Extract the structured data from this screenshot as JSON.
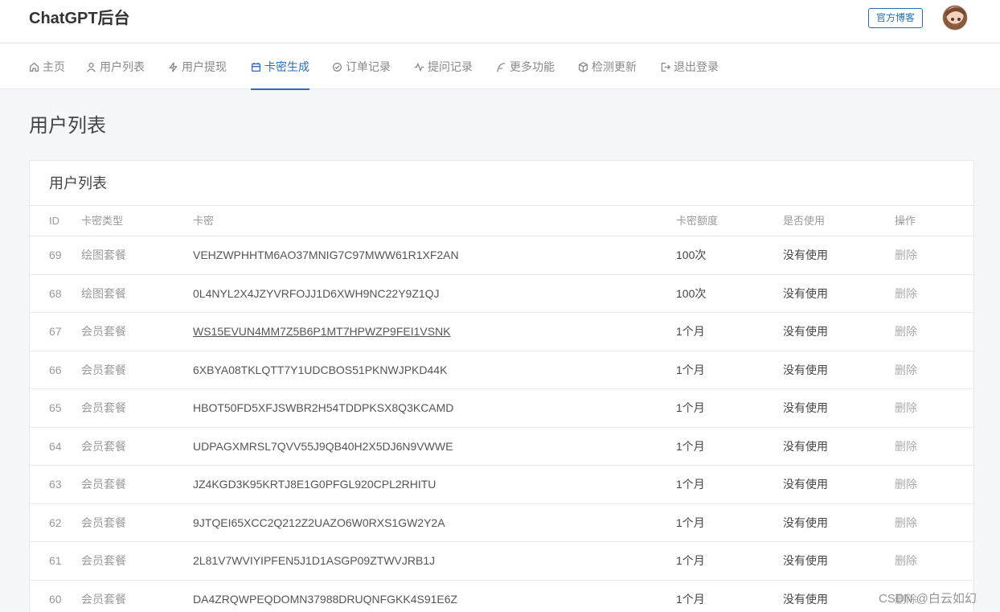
{
  "header": {
    "brand": "ChatGPT后台",
    "blog_button": "官方博客"
  },
  "nav": [
    {
      "label": "主页",
      "icon": "home-icon"
    },
    {
      "label": "用户列表",
      "icon": "user-icon"
    },
    {
      "label": "用户提现",
      "icon": "lightning-icon"
    },
    {
      "label": "卡密生成",
      "icon": "calendar-icon",
      "active": true
    },
    {
      "label": "订单记录",
      "icon": "check-circle-icon"
    },
    {
      "label": "提问记录",
      "icon": "activity-icon"
    },
    {
      "label": "更多功能",
      "icon": "feather-icon"
    },
    {
      "label": "检测更新",
      "icon": "box-icon"
    },
    {
      "label": "退出登录",
      "icon": "logout-icon"
    }
  ],
  "page_title": "用户列表",
  "card": {
    "title": "用户列表",
    "columns": [
      "ID",
      "卡密类型",
      "卡密",
      "卡密额度",
      "是否使用",
      "操作"
    ],
    "rows": [
      {
        "id": "69",
        "type": "绘图套餐",
        "key": "VEHZWPHHTM6AO37MNIG7C97MWW61R1XF2AN",
        "amount": "100次",
        "used": "没有使用",
        "op": "删除"
      },
      {
        "id": "68",
        "type": "绘图套餐",
        "key": "0L4NYL2X4JZYVRFOJJ1D6XWH9NC22Y9Z1QJ",
        "amount": "100次",
        "used": "没有使用",
        "op": "删除"
      },
      {
        "id": "67",
        "type": "会员套餐",
        "key": "WS15EVUN4MM7Z5B6P1MT7HPWZP9FEI1VSNK",
        "amount": "1个月",
        "used": "没有使用",
        "op": "删除"
      },
      {
        "id": "66",
        "type": "会员套餐",
        "key": "6XBYA08TKLQTT7Y1UDCBOS51PKNWJPKD44K",
        "amount": "1个月",
        "used": "没有使用",
        "op": "删除"
      },
      {
        "id": "65",
        "type": "会员套餐",
        "key": "HBOT50FD5XFJSWBR2H54TDDPKSX8Q3KCAMD",
        "amount": "1个月",
        "used": "没有使用",
        "op": "删除"
      },
      {
        "id": "64",
        "type": "会员套餐",
        "key": "UDPAGXMRSL7QVV55J9QB40H2X5DJ6N9VWWE",
        "amount": "1个月",
        "used": "没有使用",
        "op": "删除"
      },
      {
        "id": "63",
        "type": "会员套餐",
        "key": "JZ4KGD3K95KRTJ8E1G0PFGL920CPL2RHITU",
        "amount": "1个月",
        "used": "没有使用",
        "op": "删除"
      },
      {
        "id": "62",
        "type": "会员套餐",
        "key": "9JTQEI65XCC2Q212Z2UAZO6W0RXS1GW2Y2A",
        "amount": "1个月",
        "used": "没有使用",
        "op": "删除"
      },
      {
        "id": "61",
        "type": "会员套餐",
        "key": "2L81V7WVIYIPFEN5J1D1ASGP09ZTWVJRB1J",
        "amount": "1个月",
        "used": "没有使用",
        "op": "删除"
      },
      {
        "id": "60",
        "type": "会员套餐",
        "key": "DA4ZRQWPEQDOMN37988DRUQNFGKK4S91E6Z",
        "amount": "1个月",
        "used": "没有使用",
        "op": "删除"
      }
    ]
  },
  "watermark": "CSDN @白云如幻",
  "colors": {
    "accent": "#2a6db5",
    "muted": "#999999"
  }
}
